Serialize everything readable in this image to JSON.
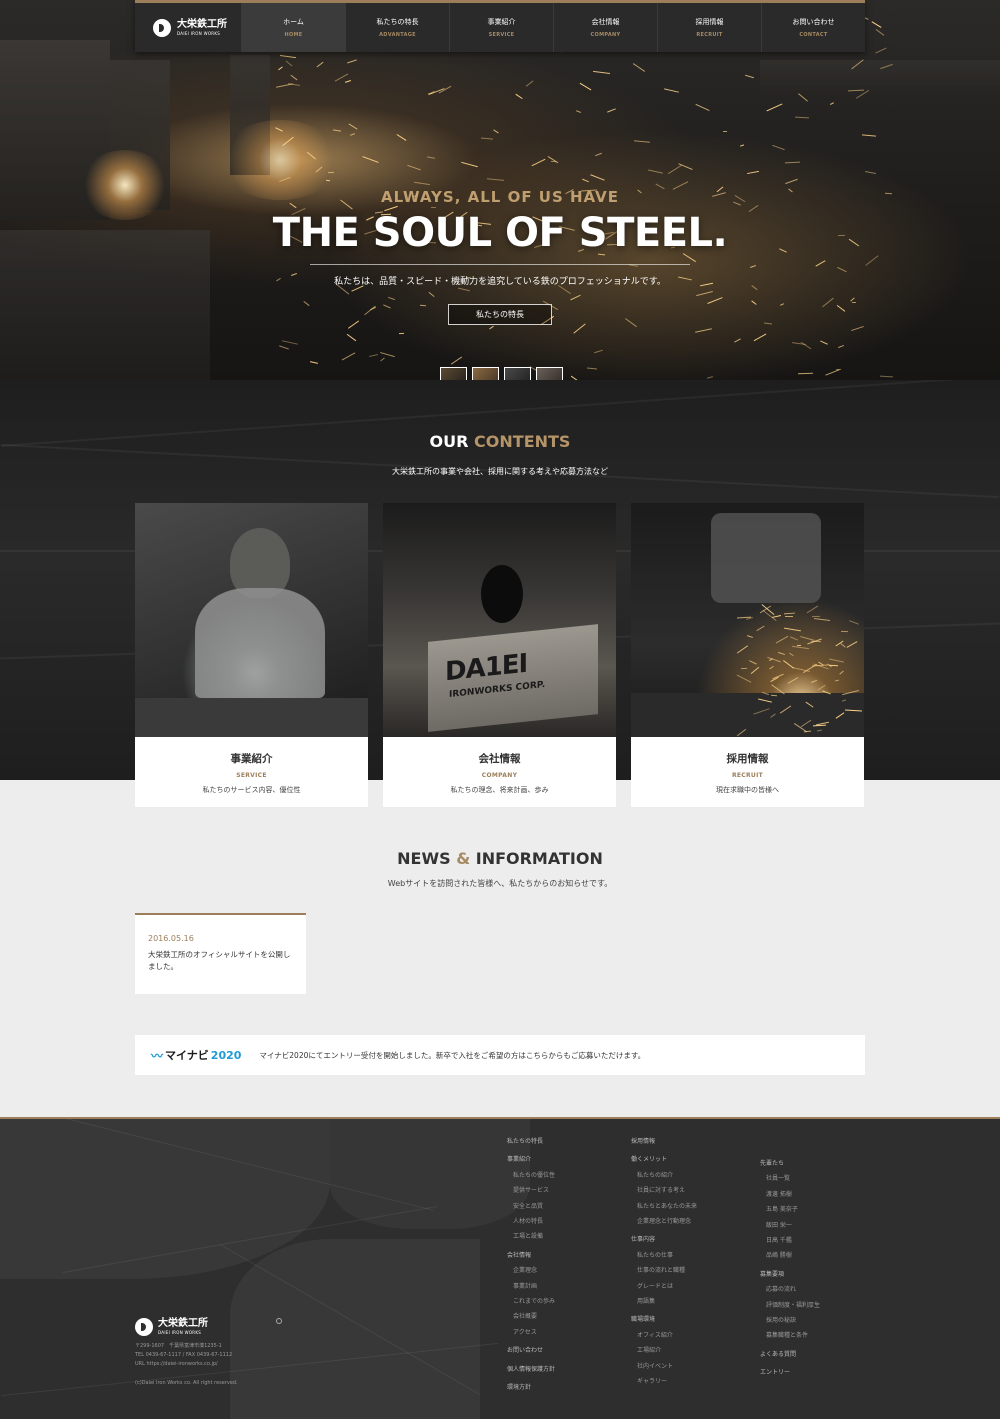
{
  "brand": {
    "name_jp": "大栄鉄工所",
    "name_en": "DAIEI IRON WORKS"
  },
  "nav": [
    {
      "jp": "ホーム",
      "en": "HOME"
    },
    {
      "jp": "私たちの特長",
      "en": "ADVANTAGE"
    },
    {
      "jp": "事業紹介",
      "en": "SERVICE"
    },
    {
      "jp": "会社情報",
      "en": "COMPANY"
    },
    {
      "jp": "採用情報",
      "en": "RECRUIT"
    },
    {
      "jp": "お問い合わせ",
      "en": "CONTACT"
    }
  ],
  "hero": {
    "subtitle": "ALWAYS, ALL OF US HAVE",
    "title": "THE SOUL OF STEEL.",
    "description": "私たちは、品質・スピード・機動力を追究している鉄のプロフェッショナルです。",
    "button": "私たちの特長"
  },
  "contents": {
    "title_a": "OUR",
    "title_b": "CONTENTS",
    "subtitle": "大栄鉄工所の事業や会社、採用に関する考えや応募方法など",
    "cards": [
      {
        "jp": "事業紹介",
        "en": "SERVICE",
        "desc": "私たちのサービス内容、優位性"
      },
      {
        "jp": "会社情報",
        "en": "COMPANY",
        "desc": "私たちの理念、将来計画、歩み"
      },
      {
        "jp": "採用情報",
        "en": "RECRUIT",
        "desc": "現在求職中の皆様へ"
      }
    ],
    "photo_sign": {
      "line1": "DA1EI",
      "line2": "IRONWORKS CORP."
    }
  },
  "news": {
    "title_a": "NEWS",
    "amp": "&",
    "title_b": "INFORMATION",
    "subtitle": "Webサイトを訪問された皆様へ、私たちからのお知らせです。",
    "items": [
      {
        "date": "2016.05.16",
        "text": "大栄鉄工所のオフィシャルサイトを公開しました。"
      }
    ]
  },
  "mynavi": {
    "logo_text": "マイナビ",
    "logo_year": "2020",
    "message": "マイナビ2020にてエントリー受付を開始しました。新卒で入社をご希望の方はこちらからもご応募いただけます。"
  },
  "footer": {
    "address": "〒299-1607　千葉県富津市湊1235-1",
    "tel_fax": "TEL 0439-67-1117 / FAX 0439-67-1112",
    "url": "URL https://daiei-ironworks.co.jp/",
    "copyright": "(c)Daiei Iron Works co. All right reserved.",
    "col1": [
      {
        "t": "私たちの特長",
        "sub": false
      },
      {
        "t": "事業紹介",
        "sub": false
      },
      {
        "t": "私たちの優位性",
        "sub": true
      },
      {
        "t": "提供サービス",
        "sub": true
      },
      {
        "t": "安全と品質",
        "sub": true
      },
      {
        "t": "人材の特長",
        "sub": true
      },
      {
        "t": "工場と設備",
        "sub": true
      },
      {
        "t": "会社情報",
        "sub": false
      },
      {
        "t": "企業理念",
        "sub": true
      },
      {
        "t": "事業計画",
        "sub": true
      },
      {
        "t": "これまでの歩み",
        "sub": true
      },
      {
        "t": "会社概要",
        "sub": true
      },
      {
        "t": "アクセス",
        "sub": true
      },
      {
        "t": "お問い合わせ",
        "sub": false
      },
      {
        "t": "個人情報保護方針",
        "sub": false
      },
      {
        "t": "環境方針",
        "sub": false
      }
    ],
    "col2": [
      {
        "t": "採用情報",
        "sub": false
      },
      {
        "t": "働くメリット",
        "sub": false
      },
      {
        "t": "私たちの紹介",
        "sub": true
      },
      {
        "t": "社員に対する考え",
        "sub": true
      },
      {
        "t": "私たちとあなたの未来",
        "sub": true
      },
      {
        "t": "企業理念と行動理念",
        "sub": true
      },
      {
        "t": "仕事内容",
        "sub": false
      },
      {
        "t": "私たちの仕事",
        "sub": true
      },
      {
        "t": "仕事の流れと職種",
        "sub": true
      },
      {
        "t": "グレードとは",
        "sub": true
      },
      {
        "t": "用語集",
        "sub": true
      },
      {
        "t": "職場環境",
        "sub": false
      },
      {
        "t": "オフィス紹介",
        "sub": true
      },
      {
        "t": "工場紹介",
        "sub": true
      },
      {
        "t": "社内イベント",
        "sub": true
      },
      {
        "t": "ギャラリー",
        "sub": true
      }
    ],
    "col3": [
      {
        "t": "先輩たち",
        "sub": false
      },
      {
        "t": "社員一覧",
        "sub": true
      },
      {
        "t": "渡邊 拓樹",
        "sub": true
      },
      {
        "t": "五島 美奈子",
        "sub": true
      },
      {
        "t": "飯田 栄一",
        "sub": true
      },
      {
        "t": "日高 千艦",
        "sub": true
      },
      {
        "t": "品嶋 勝樹",
        "sub": true
      },
      {
        "t": "募集要項",
        "sub": false
      },
      {
        "t": "応募の流れ",
        "sub": true
      },
      {
        "t": "評価制度・福利厚生",
        "sub": true
      },
      {
        "t": "採用の秘訣",
        "sub": true
      },
      {
        "t": "募集職種と条件",
        "sub": true
      },
      {
        "t": "よくある質問",
        "sub": false
      },
      {
        "t": "エントリー",
        "sub": false
      }
    ]
  }
}
